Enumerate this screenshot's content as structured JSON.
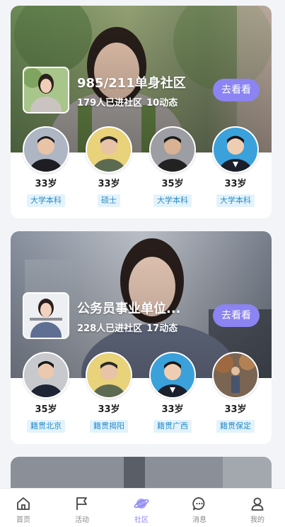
{
  "communities": [
    {
      "title": "985/211单身社区",
      "members_joined": "179人已进社区",
      "posts": "10动态",
      "action_label": "去看看",
      "members": [
        {
          "age": "33岁",
          "tag": "大学本科"
        },
        {
          "age": "33岁",
          "tag": "硕士"
        },
        {
          "age": "35岁",
          "tag": "大学本科"
        },
        {
          "age": "33岁",
          "tag": "大学本科"
        }
      ]
    },
    {
      "title": "公务员事业单位...",
      "members_joined": "228人已进社区",
      "posts": "17动态",
      "action_label": "去看看",
      "members": [
        {
          "age": "35岁",
          "tag": "籍贯北京"
        },
        {
          "age": "33岁",
          "tag": "籍贯揭阳"
        },
        {
          "age": "33岁",
          "tag": "籍贯广西"
        },
        {
          "age": "33岁",
          "tag": "籍贯保定"
        }
      ]
    }
  ],
  "tabbar": {
    "active": "社区",
    "items": [
      {
        "label": "首页",
        "icon": "home-icon"
      },
      {
        "label": "活动",
        "icon": "flag-icon"
      },
      {
        "label": "社区",
        "icon": "planet-icon"
      },
      {
        "label": "消息",
        "icon": "chat-bubble-icon"
      },
      {
        "label": "我的",
        "icon": "user-icon"
      }
    ]
  },
  "colors": {
    "accent": "#8b84f2",
    "tag_text": "#2a8bc7",
    "tag_bg": "#e3f3fb"
  }
}
